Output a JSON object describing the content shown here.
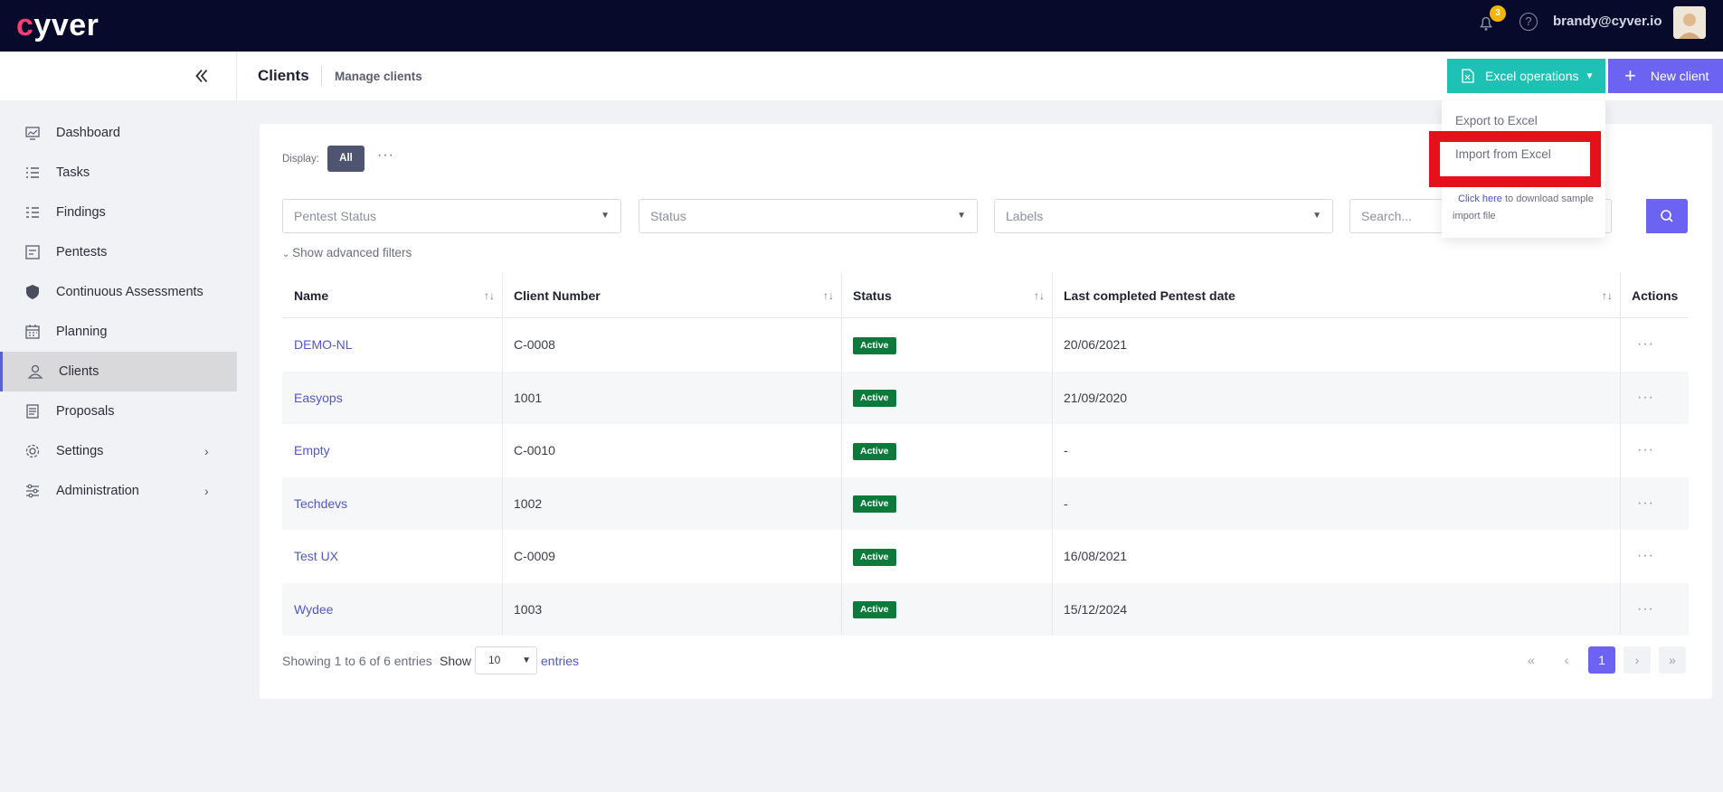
{
  "app": {
    "logo_text": "cyver",
    "notification_count": "3",
    "user_email": "brandy@cyver.io"
  },
  "sidebar": {
    "items": [
      {
        "label": "Dashboard",
        "icon": "dashboard-icon"
      },
      {
        "label": "Tasks",
        "icon": "tasks-icon"
      },
      {
        "label": "Findings",
        "icon": "findings-icon"
      },
      {
        "label": "Pentests",
        "icon": "pentests-icon"
      },
      {
        "label": "Continuous Assessments",
        "icon": "shield-icon"
      },
      {
        "label": "Planning",
        "icon": "calendar-icon"
      },
      {
        "label": "Clients",
        "icon": "clients-icon"
      },
      {
        "label": "Proposals",
        "icon": "proposals-icon"
      },
      {
        "label": "Settings",
        "icon": "gear-icon"
      },
      {
        "label": "Administration",
        "icon": "sliders-icon"
      }
    ]
  },
  "header": {
    "title": "Clients",
    "subtitle": "Manage clients",
    "excel_label": "Excel operations",
    "new_label": "New client"
  },
  "excel_menu": {
    "export_label": "Export to Excel",
    "import_label": "Import from Excel",
    "note_link": "Click here",
    "note_text": "to download sample import file"
  },
  "display": {
    "label": "Display:",
    "all_label": "All",
    "more": "···"
  },
  "filters": {
    "pentest_status": "Pentest Status",
    "status": "Status",
    "labels": "Labels",
    "search_placeholder": "Search...",
    "advanced": "Show advanced filters"
  },
  "table": {
    "headers": {
      "name": "Name",
      "client_number": "Client Number",
      "status": "Status",
      "last_date": "Last completed Pentest date",
      "actions": "Actions"
    },
    "rows": [
      {
        "name": "DEMO-NL",
        "number": "C-0008",
        "status": "Active",
        "date": "20/06/2021"
      },
      {
        "name": "Easyops",
        "number": "1001",
        "status": "Active",
        "date": "21/09/2020"
      },
      {
        "name": "Empty",
        "number": "C-0010",
        "status": "Active",
        "date": "-"
      },
      {
        "name": "Techdevs",
        "number": "1002",
        "status": "Active",
        "date": "-"
      },
      {
        "name": "Test UX",
        "number": "C-0009",
        "status": "Active",
        "date": "16/08/2021"
      },
      {
        "name": "Wydee",
        "number": "1003",
        "status": "Active",
        "date": "15/12/2024"
      }
    ],
    "row_action": "···"
  },
  "footer": {
    "info": "Showing 1 to 6 of 6 entries",
    "show": "Show",
    "page_size": "10",
    "entries": "entries",
    "current_page": "1"
  },
  "colors": {
    "topbar": "#070a2a",
    "accent": "#6c63f2",
    "excel": "#1ec2b4",
    "active_badge": "#0b7a3a",
    "highlight": "#e4101a"
  }
}
